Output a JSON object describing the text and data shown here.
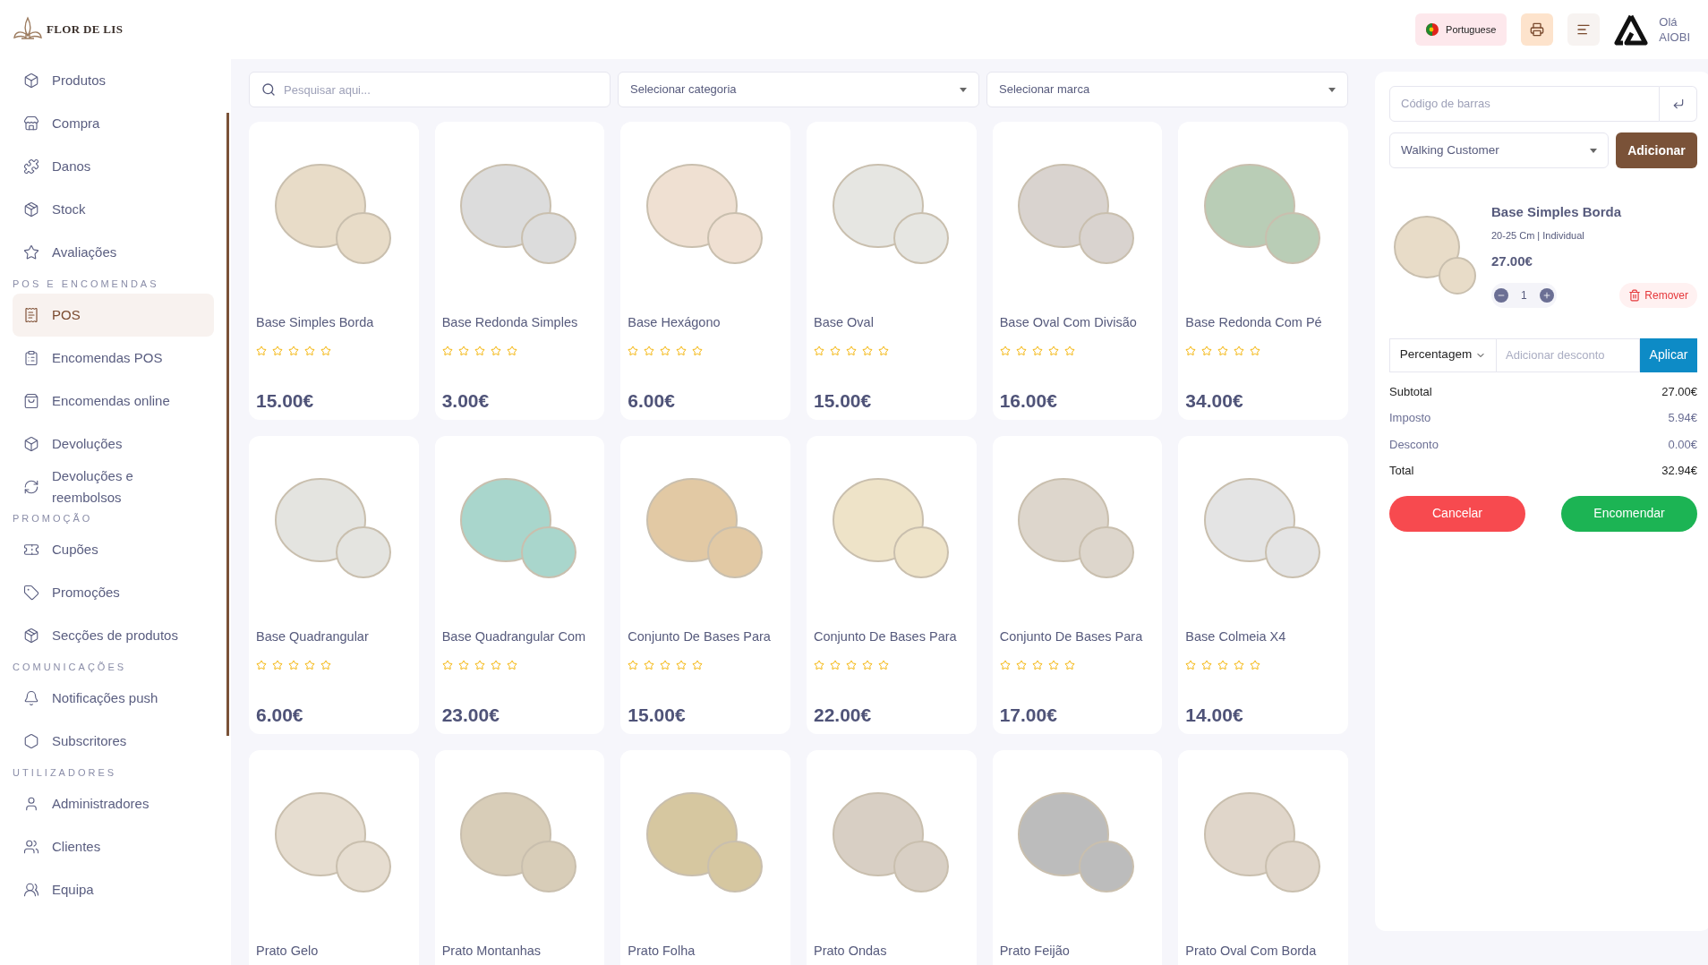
{
  "header": {
    "brand": "FLOR DE LIS",
    "language": "Portuguese",
    "greeting": "Olá",
    "user": "AIOBI"
  },
  "sidebar": {
    "groups": [
      {
        "items": [
          {
            "label": "Produtos",
            "selected": false
          },
          {
            "label": "Compra",
            "selected": false
          },
          {
            "label": "Danos",
            "selected": false
          },
          {
            "label": "Stock",
            "selected": false
          },
          {
            "label": "Avaliações",
            "selected": false
          }
        ]
      },
      {
        "heading": "POS E ENCOMENDAS",
        "items": [
          {
            "label": "POS",
            "selected": true
          },
          {
            "label": "Encomendas POS",
            "selected": false
          },
          {
            "label": "Encomendas online",
            "selected": false
          },
          {
            "label": "Devoluções",
            "selected": false
          },
          {
            "label": "Devoluções e reembolsos",
            "selected": false
          }
        ]
      },
      {
        "heading": "PROMOÇÃO",
        "items": [
          {
            "label": "Cupões",
            "selected": false
          },
          {
            "label": "Promoções",
            "selected": false
          },
          {
            "label": "Secções de produtos",
            "selected": false
          }
        ]
      },
      {
        "heading": "COMUNICAÇÕES",
        "items": [
          {
            "label": "Notificações push",
            "selected": false
          },
          {
            "label": "Subscritores",
            "selected": false
          }
        ]
      },
      {
        "heading": "UTILIZADORES",
        "items": [
          {
            "label": "Administradores",
            "selected": false
          },
          {
            "label": "Clientes",
            "selected": false
          },
          {
            "label": "Equipa",
            "selected": false
          }
        ]
      }
    ]
  },
  "filters": {
    "search_placeholder": "Pesquisar aqui...",
    "category": "Selecionar categoria",
    "brand": "Selecionar marca"
  },
  "products": [
    {
      "name": "Base Simples Borda",
      "stars": 0,
      "price": "15.00€"
    },
    {
      "name": "Base Redonda Simples",
      "stars": 0,
      "price": "3.00€"
    },
    {
      "name": "Base Hexágono",
      "stars": 0,
      "price": "6.00€"
    },
    {
      "name": "Base Oval",
      "stars": 0,
      "price": "15.00€"
    },
    {
      "name": "Base Oval Com Divisão",
      "stars": 0,
      "price": "16.00€"
    },
    {
      "name": "Base Redonda Com Pé",
      "stars": 0,
      "price": "34.00€"
    },
    {
      "name": "Base Quadrangular",
      "stars": 0,
      "price": "6.00€"
    },
    {
      "name": "Base Quadrangular Com",
      "stars": 0,
      "price": "23.00€"
    },
    {
      "name": "Conjunto De Bases Para",
      "stars": 0,
      "price": "15.00€"
    },
    {
      "name": "Conjunto De Bases Para",
      "stars": 0,
      "price": "22.00€"
    },
    {
      "name": "Conjunto De Bases Para",
      "stars": 0,
      "price": "17.00€"
    },
    {
      "name": "Base Colmeia X4",
      "stars": 0,
      "price": "14.00€"
    },
    {
      "name": "Prato Gelo"
    },
    {
      "name": "Prato Montanhas"
    },
    {
      "name": "Prato Folha"
    },
    {
      "name": "Prato Ondas"
    },
    {
      "name": "Prato Feijão"
    },
    {
      "name": "Prato Oval Com Borda"
    }
  ],
  "cart": {
    "barcode_placeholder": "Código de barras",
    "customer": "Walking Customer",
    "add_button": "Adicionar",
    "items": [
      {
        "name": "Base Simples Borda",
        "variant": "20-25 Cm | Individual",
        "price": "27.00€",
        "quantity": "1",
        "remove": "Remover"
      }
    ],
    "discount": {
      "type": "Percentagem",
      "placeholder": "Adicionar desconto",
      "apply": "Aplicar"
    },
    "summary": [
      {
        "label": "Subtotal",
        "value": "27.00€",
        "emphasis": true
      },
      {
        "label": "Imposto",
        "value": "5.94€",
        "emphasis": false
      },
      {
        "label": "Desconto",
        "value": "0.00€",
        "emphasis": false
      },
      {
        "label": "Total",
        "value": "32.94€",
        "emphasis": true
      }
    ],
    "cancel": "Cancelar",
    "order": "Encomendar"
  }
}
